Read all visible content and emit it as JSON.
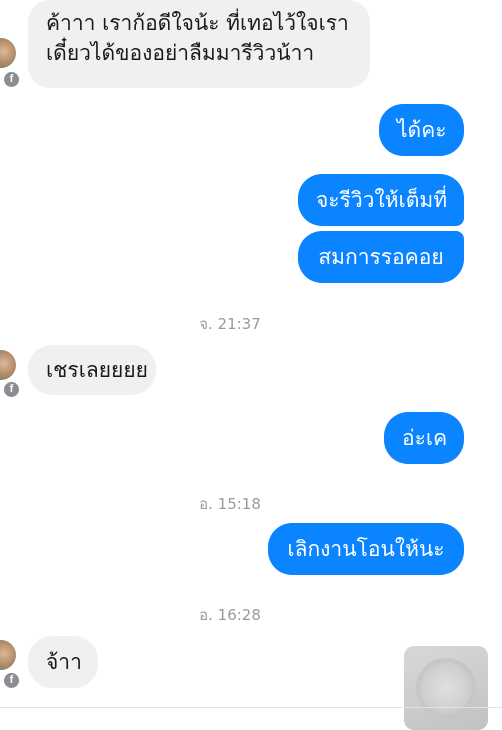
{
  "messages": {
    "m1_line1": "ค้าาา เราก้อดีใจน้ะ ที่เทอไว้ใจเรา",
    "m1_line2": "เดี๋ยวได้ของอย่าลืมมารีวิวน้าา",
    "m2": "ได้คะ",
    "m3": "จะรีวิวให้เต็มที่",
    "m4": "สมการรอคอย",
    "m5": "เชรเลยยยย",
    "m6": "อ่ะเค",
    "m7": "เลิกงานโอนให้นะ",
    "m8": "จ้าา"
  },
  "timestamps": {
    "t1": "จ. 21:37",
    "t2": "อ. 15:18",
    "t3": "อ. 16:28"
  },
  "badge": {
    "letter": "f"
  },
  "colors": {
    "outgoing": "#0b84ff",
    "incoming": "#f0f0f0",
    "timestamp": "#9a9a9a"
  },
  "icons": {
    "avatar": "contact-avatar",
    "badge": "facebook-badge-icon"
  }
}
